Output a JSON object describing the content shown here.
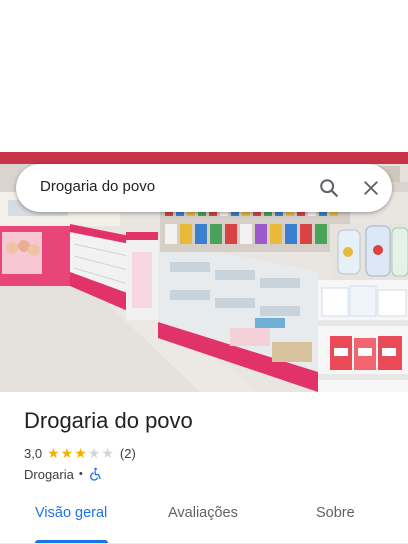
{
  "search": {
    "query": "Drogaria do povo",
    "search_icon": "search-icon",
    "close_icon": "close-icon"
  },
  "photo": {
    "description_icon": "store-photo"
  },
  "place": {
    "name": "Drogaria do povo",
    "rating": "3,0",
    "stars_filled": 3,
    "stars_total": 5,
    "review_count": "(2)",
    "category": "Drogaria",
    "separator": "•",
    "accessibility_icon": "wheelchair-icon"
  },
  "tabs": [
    {
      "label": "Visão geral",
      "active": true
    },
    {
      "label": "Avaliações",
      "active": false
    },
    {
      "label": "Sobre",
      "active": false
    }
  ],
  "colors": {
    "accent": "#1a73e8",
    "star": "#f2b200",
    "star_empty": "#d5d5d5",
    "title": "#202124"
  }
}
